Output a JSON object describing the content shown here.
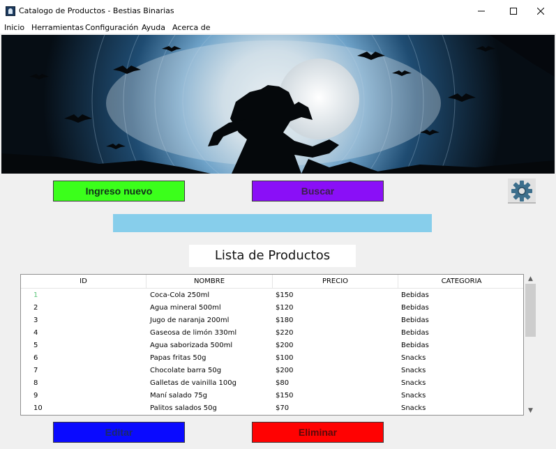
{
  "window": {
    "title": "Catalogo de Productos - Bestias Binarias",
    "icon": "werewolf-app-icon"
  },
  "menu": [
    "Inicio",
    "Herramientas",
    "Configuración",
    "Ayuda",
    "Acerca de"
  ],
  "banner": {
    "image": "werewolf-full-moon-binary-code-banner",
    "colors": {
      "moon": "#dfe8ee",
      "glow": "#4b89b8",
      "sky": "#0b1620"
    }
  },
  "actions": {
    "ingreso": "Ingreso nuevo",
    "buscar": "Buscar",
    "editar": "Editar",
    "eliminar": "Eliminar",
    "settings_icon": "gear-icon"
  },
  "search": {
    "value": "",
    "placeholder": ""
  },
  "list_title": "Lista de Productos",
  "table": {
    "columns": [
      "ID",
      "NOMBRE",
      "PRECIO",
      "CATEGORIA"
    ],
    "rows": [
      {
        "id": "1",
        "nombre": "Coca-Cola 250ml",
        "precio": "$150",
        "categoria": "Bebidas"
      },
      {
        "id": "2",
        "nombre": "Agua mineral 500ml",
        "precio": "$120",
        "categoria": "Bebidas"
      },
      {
        "id": "3",
        "nombre": "Jugo de naranja 200ml",
        "precio": "$180",
        "categoria": "Bebidas"
      },
      {
        "id": "4",
        "nombre": "Gaseosa de limón 330ml",
        "precio": "$220",
        "categoria": "Bebidas"
      },
      {
        "id": "5",
        "nombre": "Agua saborizada 500ml",
        "precio": "$200",
        "categoria": "Bebidas"
      },
      {
        "id": "6",
        "nombre": "Papas fritas 50g",
        "precio": "$100",
        "categoria": "Snacks"
      },
      {
        "id": "7",
        "nombre": "Chocolate barra 50g",
        "precio": "$200",
        "categoria": "Snacks"
      },
      {
        "id": "8",
        "nombre": "Galletas de vainilla 100g",
        "precio": "$80",
        "categoria": "Snacks"
      },
      {
        "id": "9",
        "nombre": "Maní salado 75g",
        "precio": "$150",
        "categoria": "Snacks"
      },
      {
        "id": "10",
        "nombre": "Palitos salados 50g",
        "precio": "$70",
        "categoria": "Snacks"
      }
    ]
  },
  "scroll": {
    "up": "▲",
    "down": "▼"
  }
}
